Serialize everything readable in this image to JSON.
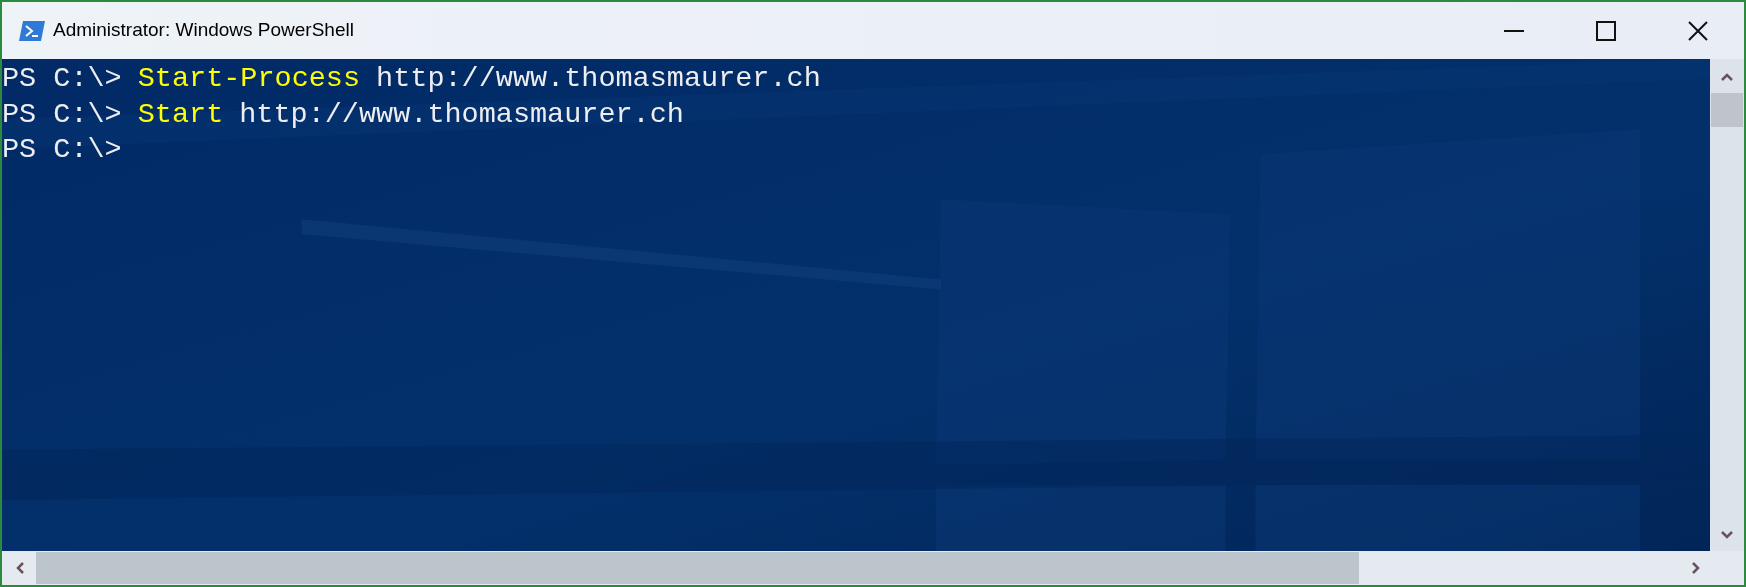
{
  "window": {
    "title": "Administrator: Windows PowerShell"
  },
  "console": {
    "lines": [
      {
        "prompt": "PS C:\\>",
        "command": "Start-Process",
        "argument": "http://www.thomasmaurer.ch"
      },
      {
        "prompt": "PS C:\\>",
        "command": "Start",
        "argument": "http://www.thomasmaurer.ch"
      },
      {
        "prompt": "PS C:\\>"
      }
    ]
  }
}
